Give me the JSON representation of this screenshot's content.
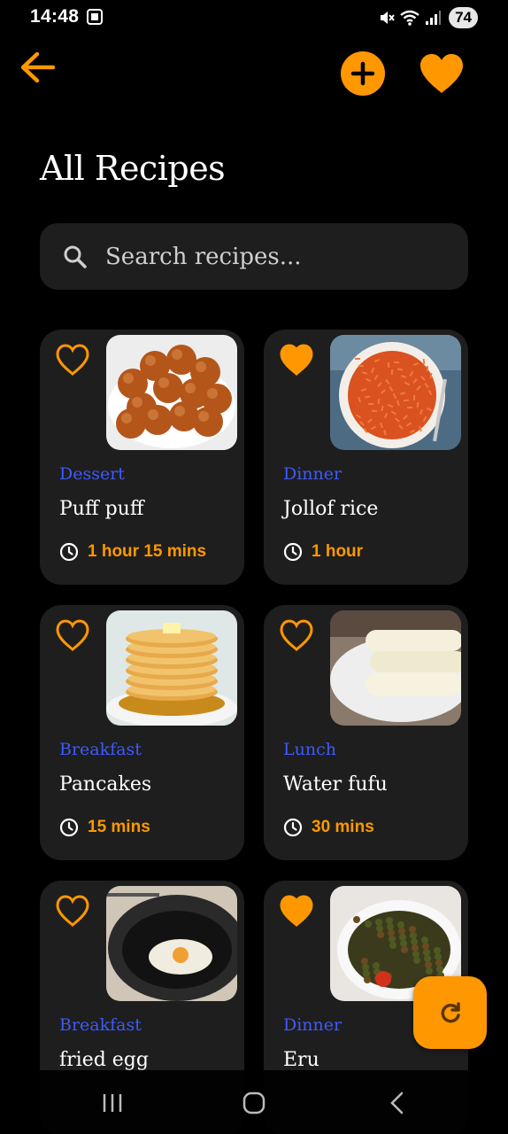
{
  "status_bar": {
    "time": "14:48",
    "battery": "74"
  },
  "header": {
    "title": "All Recipes",
    "back_icon": "arrow-left-icon",
    "add_icon": "plus-circle-icon",
    "favorites_icon": "heart-icon"
  },
  "search": {
    "placeholder": "Search recipes..."
  },
  "colors": {
    "accent": "#ff9800",
    "category": "#3d5afe",
    "card_bg": "#1e1e1e",
    "background": "#000000"
  },
  "recipes": [
    {
      "category": "Dessert",
      "name": "Puff puff",
      "time": "1 hour 15 mins",
      "favorite": false,
      "image": "puff-puff-photo"
    },
    {
      "category": "Dinner",
      "name": "Jollof rice",
      "time": "1 hour",
      "favorite": true,
      "image": "jollof-rice-photo"
    },
    {
      "category": "Breakfast",
      "name": "Pancakes",
      "time": "15 mins",
      "favorite": false,
      "image": "pancakes-photo"
    },
    {
      "category": "Lunch",
      "name": "Water fufu",
      "time": "30 mins",
      "favorite": false,
      "image": "water-fufu-photo"
    },
    {
      "category": "Breakfast",
      "name": "fried egg",
      "time": "",
      "favorite": false,
      "image": "fried-egg-photo"
    },
    {
      "category": "Dinner",
      "name": "Eru",
      "time": "",
      "favorite": true,
      "image": "eru-photo"
    }
  ],
  "fab": {
    "icon": "refresh-icon"
  }
}
